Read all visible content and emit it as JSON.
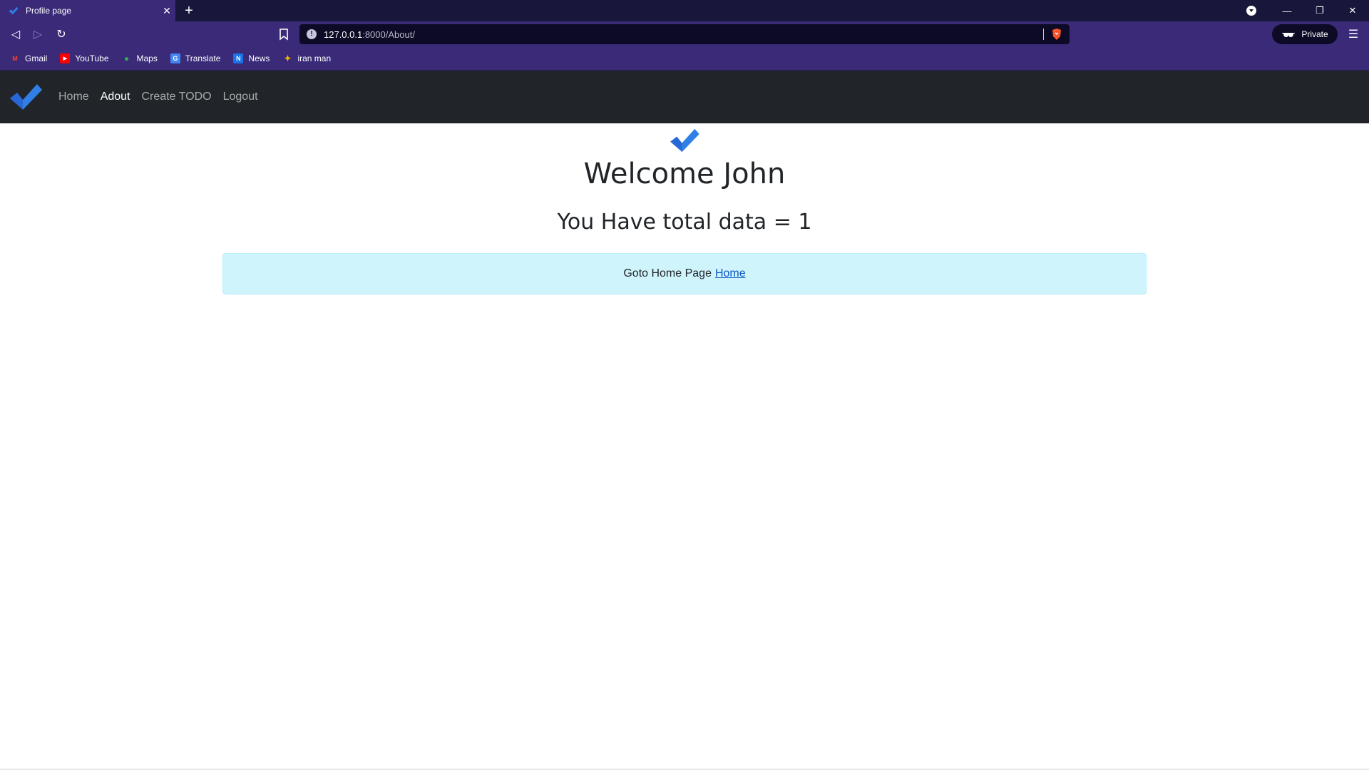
{
  "browser": {
    "tab_title": "Profile page",
    "tab_close": "✕",
    "new_tab": "+",
    "window_controls": {
      "minimize": "—",
      "restore": "❐",
      "close": "✕"
    },
    "url_host": "127.0.0.1",
    "url_path": ":8000/About/",
    "private_label": "Private",
    "menu_glyph": "☰",
    "back_glyph": "◁",
    "forward_glyph": "▷",
    "reload_glyph": "↻",
    "bookmarks": [
      {
        "label": "Gmail",
        "icon": "gmail-icon",
        "color": "#ea4335",
        "glyph": "M"
      },
      {
        "label": "YouTube",
        "icon": "youtube-icon",
        "color": "#ff0000",
        "glyph": "▶"
      },
      {
        "label": "Maps",
        "icon": "maps-icon",
        "color": "#34a853",
        "glyph": "●"
      },
      {
        "label": "Translate",
        "icon": "translate-icon",
        "color": "#4285f4",
        "glyph": "G"
      },
      {
        "label": "News",
        "icon": "news-icon",
        "color": "#1a73e8",
        "glyph": "N"
      },
      {
        "label": "iran man",
        "icon": "iran-man-icon",
        "color": "#f4b400",
        "glyph": "✦"
      }
    ]
  },
  "navbar": {
    "links": [
      "Home",
      "Adout",
      "Create TODO",
      "Logout"
    ],
    "active": "Adout"
  },
  "main": {
    "welcome": "Welcome John",
    "total": "You Have total data = 1",
    "alert_text": "Goto Home Page",
    "alert_link": "Home"
  },
  "colors": {
    "navbar_bg": "#212529",
    "alert_bg": "#cff4fc",
    "browser_purple": "#3a2a78",
    "logo_blue": "#2f7fe6"
  }
}
